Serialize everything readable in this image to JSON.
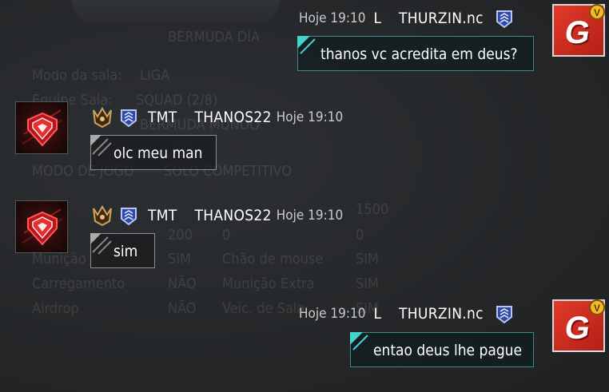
{
  "background": {
    "ghost_title": "BERMUDA DIA",
    "ghost_rows": [
      {
        "label": "Modo da sala:",
        "value": "LIGA"
      },
      {
        "label": "Equipe Sala:",
        "value": "SQUAD   (2/8)"
      },
      {
        "label": "",
        "value": "BERMUDA MUNDO"
      },
      {
        "label": "MODO DE JOGO",
        "value": "SOLO COMPETITIVO"
      },
      {
        "label": "",
        "value": "200",
        "extra1": "0",
        "extra2": "1500",
        "extra3": "0"
      },
      {
        "label": "Munição",
        "value": "SIM",
        "extra1": "Chão de mouse",
        "extra2": "SIM"
      },
      {
        "label": "Carregamento",
        "value": "NÃO",
        "extra1": "Munição Extra",
        "extra2": "SIM"
      },
      {
        "label": "Airdrop",
        "value": "NÃO",
        "extra1": "Veíc. de Sala",
        "extra2": "SIM"
      }
    ]
  },
  "messages": [
    {
      "side": "right",
      "time": "Hoje 19:10",
      "tag": "L",
      "name": "THURZIN.nc",
      "text": "thanos vc acredita em deus?",
      "avatar_icon": "g-logo-icon",
      "badge": "V"
    },
    {
      "side": "left",
      "guild": "TMT",
      "name": "THANOS22",
      "time": "Hoje 19:10",
      "text": "olc meu man",
      "avatar_icon": "red-diamond-icon"
    },
    {
      "side": "left",
      "guild": "TMT",
      "name": "THANOS22",
      "time": "Hoje 19:10",
      "text": "sim",
      "avatar_icon": "red-diamond-icon"
    },
    {
      "side": "right",
      "time": "Hoje 19:10",
      "tag": "L",
      "name": "THURZIN.nc",
      "text": "entao deus lhe pague",
      "avatar_icon": "g-logo-icon",
      "badge": "V"
    }
  ],
  "colors": {
    "accent_teal": "#47d1d1",
    "bubble_border_left": "#8c8f92",
    "bubble_border_right": "#3a8a8a",
    "avatar_red": "#e23b2a",
    "badge_gold": "#f3b928"
  }
}
